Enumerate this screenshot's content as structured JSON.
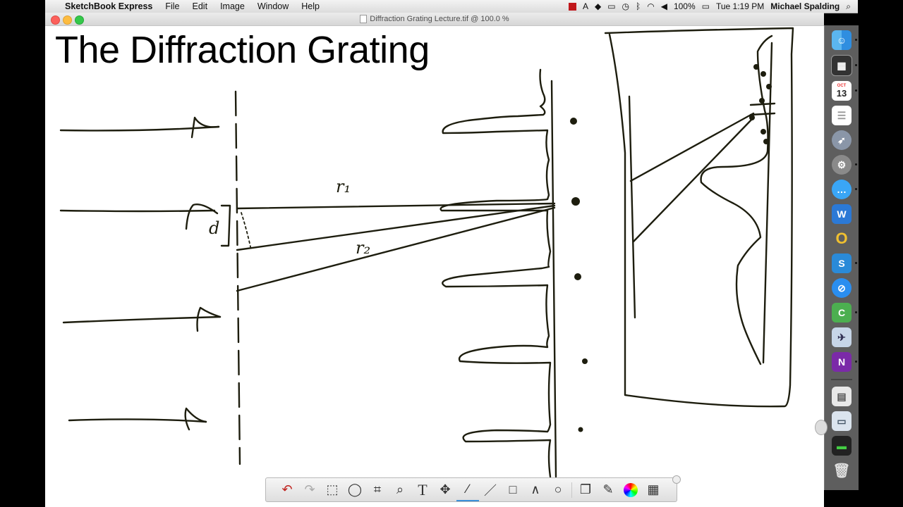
{
  "menubar": {
    "app_name": "SketchBook Express",
    "menus": [
      "File",
      "Edit",
      "Image",
      "Window",
      "Help"
    ],
    "battery": "100%",
    "clock": "Tue 1:19 PM",
    "user": "Michael Spalding"
  },
  "window": {
    "title": "Diffraction Grating Lecture.tif @ 100.0 %"
  },
  "canvas": {
    "heading": "The Diffraction Grating",
    "labels": {
      "r1": "r₁",
      "r2": "r₂",
      "d": "d"
    }
  },
  "dock": {
    "calendar_day": "13",
    "calendar_month": "OCT"
  }
}
